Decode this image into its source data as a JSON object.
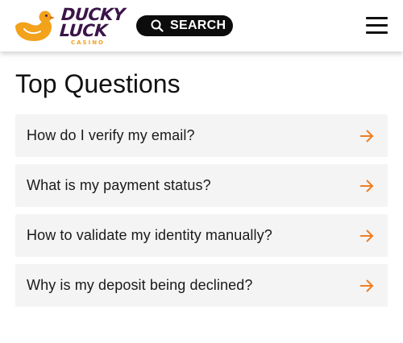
{
  "header": {
    "logo": {
      "line1": "DUCKY",
      "line2": "LUCK",
      "sub": "CASINO"
    },
    "search": {
      "label": "SEARCH",
      "icon": "search-icon"
    },
    "menu_icon": "hamburger-menu-icon"
  },
  "main": {
    "title": "Top Questions",
    "questions": [
      {
        "text": "How do I verify my email?"
      },
      {
        "text": "What is my payment status?"
      },
      {
        "text": "How to validate my identity manually?"
      },
      {
        "text": "Why is my deposit being declined?"
      }
    ],
    "arrow_icon": "arrow-right-icon"
  },
  "colors": {
    "brand_purple": "#3b1549",
    "brand_orange": "#f2a21b",
    "arrow_orange": "#ef7d22",
    "card_background": "#f4f4f4",
    "search_background": "#0c0c0c"
  }
}
